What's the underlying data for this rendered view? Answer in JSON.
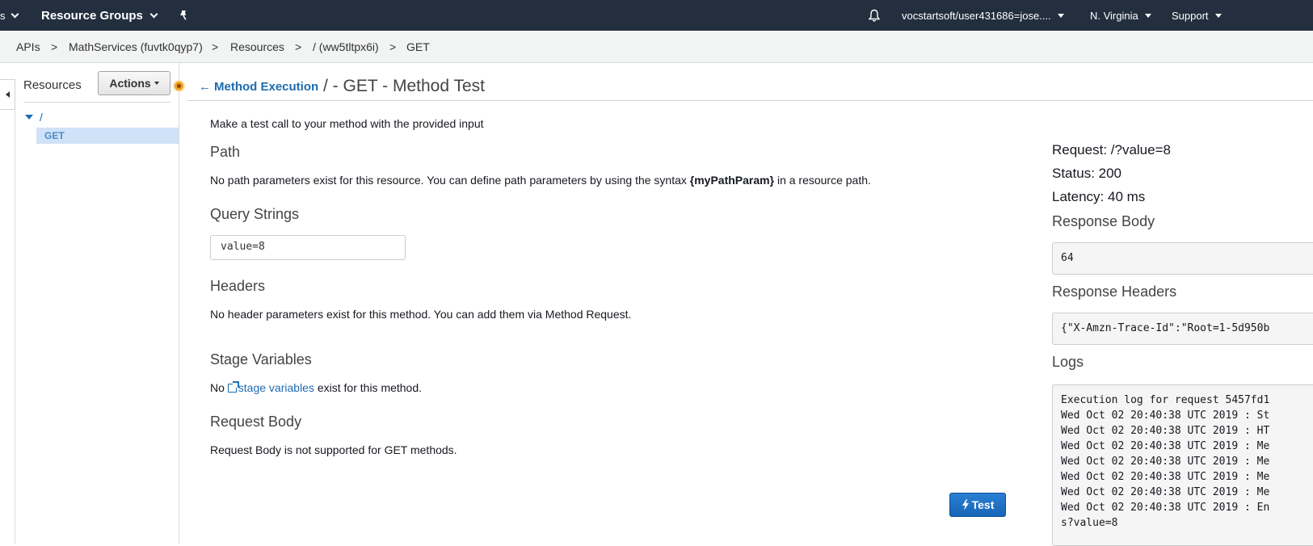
{
  "navbar": {
    "services_fragment": "s",
    "resource_groups": "Resource Groups",
    "account": "vocstartsoft/user431686=jose....",
    "region": "N. Virginia",
    "support": "Support"
  },
  "breadcrumb": {
    "apis": "APIs",
    "api_name": "MathServices (fuvtk0qyp7)",
    "resources": "Resources",
    "resource": "/ (ww5tltpx6i)",
    "method": "GET",
    "separator": ">"
  },
  "sidebar": {
    "title": "Resources",
    "actions_label": "Actions",
    "tree_root": "/",
    "tree_method": "GET"
  },
  "header": {
    "back_label": "Method Execution",
    "title": "/ - GET - Method Test"
  },
  "test_form": {
    "intro": "Make a test call to your method with the provided input",
    "path_heading": "Path",
    "path_text_before": "No path parameters exist for this resource. You can define path parameters by using the syntax ",
    "path_text_code": "{myPathParam}",
    "path_text_after": " in a resource path.",
    "query_heading": "Query Strings",
    "query_value": "value=8",
    "headers_heading": "Headers",
    "headers_text": "No header parameters exist for this method. You can add them via Method Request.",
    "stage_heading": "Stage Variables",
    "stage_before": "No ",
    "stage_link": "stage variables",
    "stage_after": " exist for this method.",
    "body_heading": "Request Body",
    "body_text": "Request Body is not supported for GET methods.",
    "test_button": "Test"
  },
  "results": {
    "request": "Request: /?value=8",
    "status": "Status: 200",
    "latency": "Latency: 40 ms",
    "response_body_heading": "Response Body",
    "response_body": "64",
    "response_headers_heading": "Response Headers",
    "response_headers": "{\"X-Amzn-Trace-Id\":\"Root=1-5d950b",
    "logs_heading": "Logs",
    "log_lines": [
      "Execution log for request 5457fd1",
      "Wed Oct 02 20:40:38 UTC 2019 : St",
      "Wed Oct 02 20:40:38 UTC 2019 : HT",
      "Wed Oct 02 20:40:38 UTC 2019 : Me",
      "Wed Oct 02 20:40:38 UTC 2019 : Me",
      "Wed Oct 02 20:40:38 UTC 2019 : Me",
      "Wed Oct 02 20:40:38 UTC 2019 : Me",
      "Wed Oct 02 20:40:38 UTC 2019 : En",
      "s?value=8"
    ]
  },
  "colors": {
    "navbar_bg": "#232f3e",
    "link": "#1f6cb0",
    "test_button": "#1f73c9"
  }
}
